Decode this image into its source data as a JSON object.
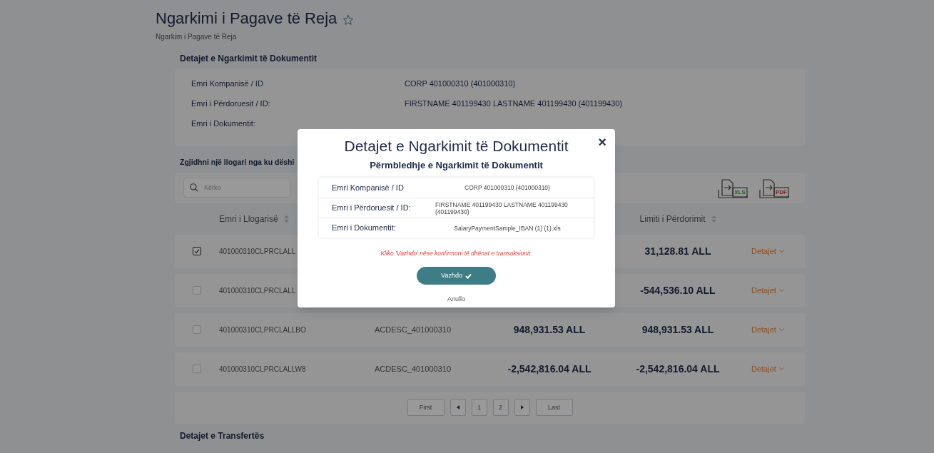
{
  "page": {
    "title": "Ngarkimi i Pagave të Reja",
    "starred": false,
    "breadcrumb": "Ngarkim i Pagave të Reja"
  },
  "upload_details": {
    "heading": "Detajet e Ngarkimit të Dokumentit",
    "fields": [
      {
        "label": "Emri Kompanisë / ID",
        "value": "CORP 401000310 (401000310)"
      },
      {
        "label": "Emri i Përdoruesit / ID:",
        "value": "FIRSTNAME 401199430 LASTNAME 401199430 (401199430)"
      },
      {
        "label": "Emri i Dokumentit:"
      }
    ]
  },
  "account_section": {
    "heading": "Zgjidhni një llogari nga ku dëshi",
    "search": {
      "placeholder": "Kërko"
    },
    "exports": [
      {
        "kind": "spreadsheet",
        "label": "XLS"
      },
      {
        "kind": "document",
        "label": "PDF"
      }
    ],
    "columns": {
      "account_name": "Emri i Llogarisë",
      "usage_limit": "Limiti i Përdorimit"
    },
    "rows": [
      {
        "selected": true,
        "account_name": "401000310CLPRCLALL",
        "usage_limit": "31,128.81 ALL",
        "details": "Detajet"
      },
      {
        "selected": false,
        "account_name": "401000310CLPRCLALL",
        "usage_limit": "-544,536.10 ALL",
        "details": "Detajet"
      },
      {
        "selected": false,
        "account_name": "401000310CLPRCLALLBO",
        "column_2": "ACDESC_401000310",
        "column_3": "948,931.53 ALL",
        "usage_limit": "948,931.53 ALL",
        "details": "Detajet"
      },
      {
        "selected": false,
        "account_name": "401000310CLPRCLALLW8",
        "column_2": "ACDESC_401000310",
        "column_3": "-2,542,816.04 ALL",
        "usage_limit": "-2,542,816.04 ALL",
        "details": "Detajet"
      }
    ],
    "pagination": {
      "first": "First",
      "pages": [
        "1",
        "2"
      ],
      "last": "Last"
    }
  },
  "next_section": {
    "heading": "Detajet e Transfertës"
  },
  "modal": {
    "title": "Detajet e Ngarkimit të Dokumentit",
    "close": "×",
    "subtitle": "Përmbledhje e Ngarkimit të Dokumentit",
    "fields": [
      {
        "label": "Emri Kompanisë / ID",
        "value": "CORP 401000310 (401000310)"
      },
      {
        "label": "Emri i Përdoruesit / ID:",
        "value": "FIRSTNAME 401199430 LASTNAME 401199430 (401199430)"
      },
      {
        "label": "Emri i Dokumentit:",
        "value": "SalaryPaymentSample_IBAN (1) (1).xls"
      }
    ],
    "note": "Kliko 'Vazhdo' nëse konfirmoni të dhënat e transaksionit.",
    "confirm": "Vazhdo",
    "cancel": "Anullo"
  }
}
